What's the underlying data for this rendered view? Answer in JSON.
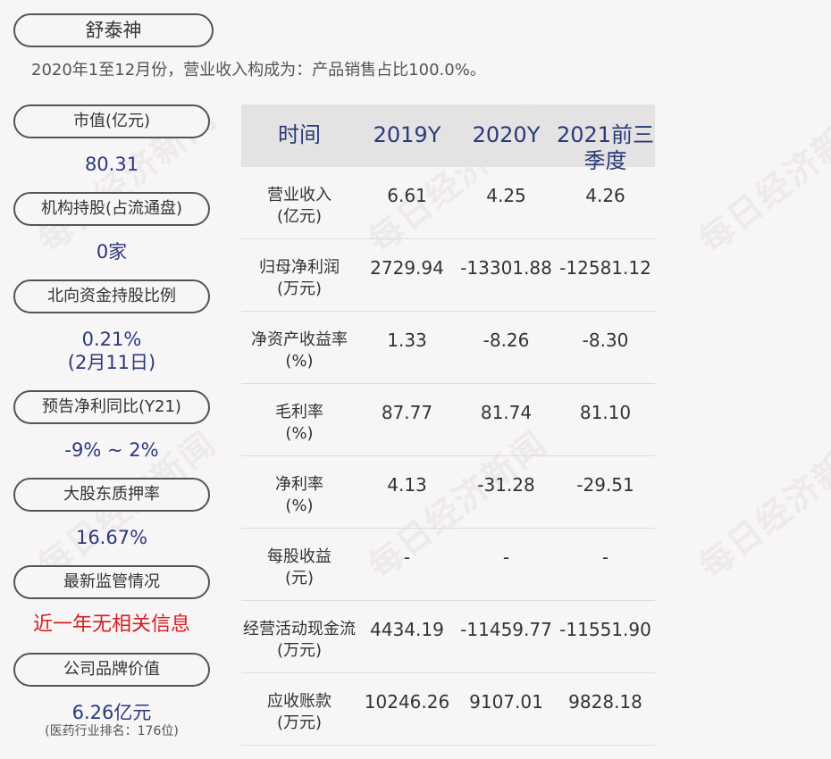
{
  "company": "舒泰神",
  "subtitle": "2020年1至12月份，营业收入构成为：产品销售占比100.0%。",
  "watermark": "每日经济新闻",
  "metrics": [
    {
      "label": "市值(亿元)",
      "value": "80.31"
    },
    {
      "label": "机构持股(占流通盘)",
      "value": "0家"
    },
    {
      "label": "北向资金持股比例",
      "value": "0.21%",
      "value2": "(2月11日)"
    },
    {
      "label": "预告净利同比(Y21)",
      "value": "-9% ~ 2%"
    },
    {
      "label": "大股东质押率",
      "value": "16.67%"
    },
    {
      "label": "最新监管情况",
      "value": "近一年无相关信息"
    },
    {
      "label": "公司品牌价值",
      "value": "6.26亿元",
      "note": "(医药行业排名：176位)"
    }
  ],
  "table": {
    "headers": [
      "时间",
      "2019Y",
      "2020Y",
      "2021前三季度"
    ],
    "rows": [
      {
        "label": "营业收入",
        "unit": "(亿元)",
        "values": [
          "6.61",
          "4.25",
          "4.26"
        ]
      },
      {
        "label": "归母净利润",
        "unit": "(万元)",
        "values": [
          "2729.94",
          "-13301.88",
          "-12581.12"
        ]
      },
      {
        "label": "净资产收益率",
        "unit": "(%)",
        "values": [
          "1.33",
          "-8.26",
          "-8.30"
        ]
      },
      {
        "label": "毛利率",
        "unit": "(%)",
        "values": [
          "87.77",
          "81.74",
          "81.10"
        ]
      },
      {
        "label": "净利率",
        "unit": "(%)",
        "values": [
          "4.13",
          "-31.28",
          "-29.51"
        ]
      },
      {
        "label": "每股收益",
        "unit": "(元)",
        "values": [
          "-",
          "-",
          "-"
        ]
      },
      {
        "label": "经营活动现金流",
        "unit": "(万元)",
        "values": [
          "4434.19",
          "-11459.77",
          "-11551.90"
        ]
      },
      {
        "label": "应收账款",
        "unit": "(万元)",
        "values": [
          "10246.26",
          "9107.01",
          "9828.18"
        ]
      }
    ]
  }
}
